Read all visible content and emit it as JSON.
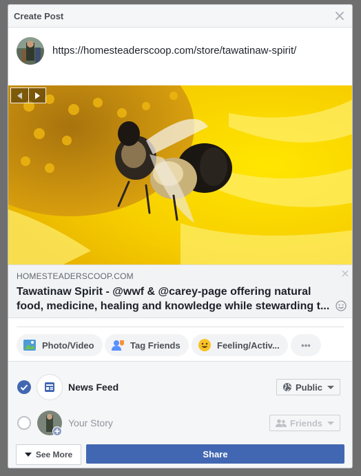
{
  "header": {
    "title": "Create Post"
  },
  "composer": {
    "text": "https://homesteaderscoop.com/store/tawatinaw-spirit/"
  },
  "link_preview": {
    "domain": "HOMESTEADERSCOOP.COM",
    "title": "Tawatinaw Spirit - @wwf & @carey-page offering natural food, medicine, healing and knowledge while stewarding t..."
  },
  "actions": {
    "photo_video": "Photo/Video",
    "tag_friends": "Tag Friends",
    "feeling": "Feeling/Activ...",
    "more": "•••"
  },
  "audience": {
    "news_feed": {
      "label": "News Feed",
      "privacy": "Public",
      "selected": true
    },
    "your_story": {
      "label": "Your Story",
      "privacy": "Friends",
      "selected": false
    }
  },
  "footer": {
    "see_more": "See More",
    "share": "Share"
  },
  "colors": {
    "accent": "#4267b2",
    "header_bg": "#f5f6f7",
    "backdrop": "#6f6f6f"
  }
}
